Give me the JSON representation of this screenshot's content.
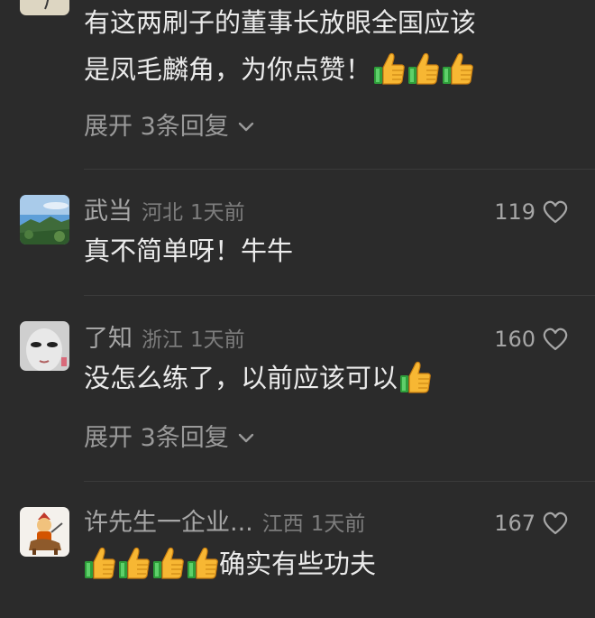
{
  "comments": [
    {
      "text_line1": "有这两刷子的董事长放眼全国应该",
      "text_line2": "是凤毛麟角，为你点赞！",
      "thumbs": 3,
      "expand_label": "展开 3条回复"
    },
    {
      "username": "武当",
      "location": "河北",
      "time": "1天前",
      "likes": "119",
      "text": "真不简单呀！牛牛"
    },
    {
      "username": "了知",
      "location": "浙江",
      "time": "1天前",
      "likes": "160",
      "text": "没怎么练了，以前应该可以",
      "thumbs": 1,
      "expand_label": "展开 3条回复"
    },
    {
      "username": "许先生一企业...",
      "location": "江西",
      "time": "1天前",
      "likes": "167",
      "text": "确实有些功夫",
      "thumbs": 4
    }
  ],
  "icons": {
    "like": "heart-outline-icon",
    "expand": "chevron-down-icon",
    "emoji": "thumbs-up-emoji"
  },
  "colors": {
    "background": "#2b2b2b",
    "text": "#ebebeb",
    "username": "#a6a6a6",
    "meta": "#7d7d7d"
  }
}
